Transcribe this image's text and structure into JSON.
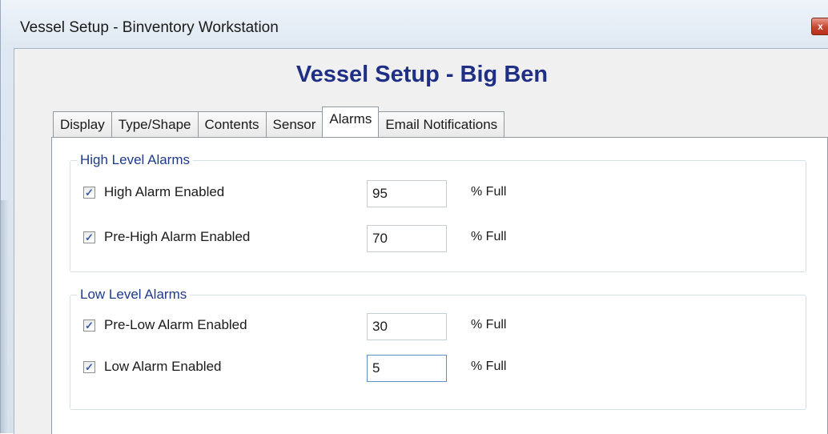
{
  "window": {
    "title": "Vessel Setup - Binventory Workstation",
    "close_glyph": "x"
  },
  "page": {
    "title": "Vessel Setup - Big Ben"
  },
  "tabs": [
    {
      "label": "Display",
      "active": false
    },
    {
      "label": "Type/Shape",
      "active": false
    },
    {
      "label": "Contents",
      "active": false
    },
    {
      "label": "Sensor",
      "active": false
    },
    {
      "label": "Alarms",
      "active": true
    },
    {
      "label": "Email Notifications",
      "active": false
    }
  ],
  "high_alarms": {
    "legend": "High Level Alarms",
    "rows": [
      {
        "label": "High Alarm Enabled",
        "checked": true,
        "value": "95",
        "unit": "% Full"
      },
      {
        "label": "Pre-High Alarm Enabled",
        "checked": true,
        "value": "70",
        "unit": "% Full"
      }
    ]
  },
  "low_alarms": {
    "legend": "Low Level Alarms",
    "rows": [
      {
        "label": "Pre-Low Alarm Enabled",
        "checked": true,
        "value": "30",
        "unit": "% Full"
      },
      {
        "label": "Low Alarm Enabled",
        "checked": true,
        "value": "5",
        "unit": "% Full"
      }
    ]
  },
  "checkmark_glyph": "✓",
  "colors": {
    "title_blue": "#1f2f86",
    "legend_blue": "#1e3a8a"
  }
}
